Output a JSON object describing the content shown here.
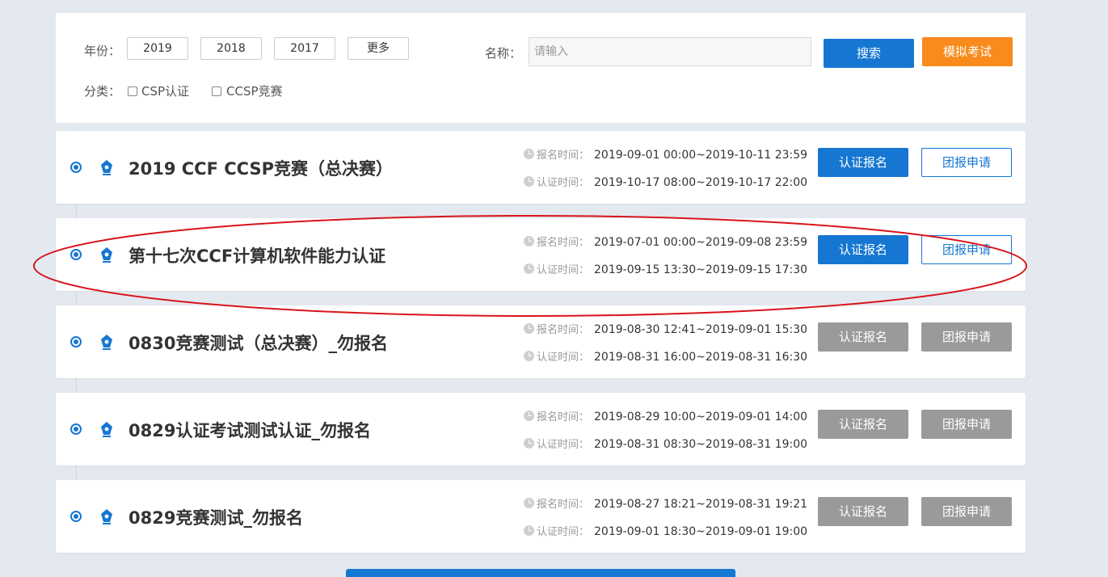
{
  "filters": {
    "year_label": "年份：",
    "years": [
      "2019",
      "2018",
      "2017"
    ],
    "more_label": "更多",
    "name_label": "名称：",
    "name_placeholder": "请输入",
    "search_label": "搜索",
    "mock_exam_label": "模拟考试",
    "category_label": "分类：",
    "categories": [
      "CSP认证",
      "CCSP竞赛"
    ]
  },
  "row_labels": {
    "register_time": "报名时间：",
    "exam_time": "认证时间："
  },
  "events": [
    {
      "title": "2019 CCF CCSP竞赛（总决赛）",
      "register_time": "2019-09-01 00:00~2019-10-11 23:59",
      "exam_time": "2019-10-17 08:00~2019-10-17 22:00",
      "register_btn": "认证报名",
      "group_btn": "团报申请",
      "status": "active"
    },
    {
      "title": "第十七次CCF计算机软件能力认证",
      "register_time": "2019-07-01 00:00~2019-09-08 23:59",
      "exam_time": "2019-09-15 13:30~2019-09-15 17:30",
      "register_btn": "认证报名",
      "group_btn": "团报申请",
      "status": "active"
    },
    {
      "title": "0830竞赛测试（总决赛）_勿报名",
      "register_time": "2019-08-30 12:41~2019-09-01 15:30",
      "exam_time": "2019-08-31 16:00~2019-08-31 16:30",
      "register_btn": "认证报名",
      "group_btn": "团报申请",
      "status": "disabled"
    },
    {
      "title": "0829认证考试测试认证_勿报名",
      "register_time": "2019-08-29 10:00~2019-09-01 14:00",
      "exam_time": "2019-08-31 08:30~2019-08-31 19:00",
      "register_btn": "认证报名",
      "group_btn": "团报申请",
      "status": "disabled"
    },
    {
      "title": "0829竞赛测试_勿报名",
      "register_time": "2019-08-27 18:21~2019-08-31 19:21",
      "exam_time": "2019-09-01 18:30~2019-09-01 19:00",
      "register_btn": "认证报名",
      "group_btn": "团报申请",
      "status": "disabled"
    }
  ],
  "colors": {
    "primary": "#1677d2",
    "accent": "#f88b1c",
    "disabled": "#9a9a9a",
    "highlight": "#d9141b"
  },
  "icons": {
    "event": "pen-icon",
    "time": "clock-icon"
  }
}
